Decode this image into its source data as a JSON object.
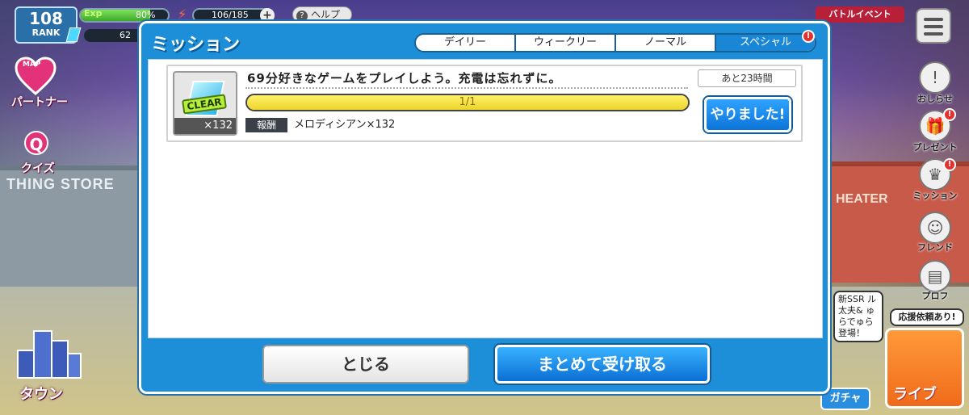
{
  "hud": {
    "rank": "108",
    "rank_label": "RANK",
    "exp_label": "Exp",
    "exp_percent": "80%",
    "exp_fraction": 0.8,
    "stamina": "106/185",
    "gems": "62",
    "help": "ヘルプ"
  },
  "left_menu": {
    "map_tag": "MAP",
    "partner": "パートナー",
    "quiz": "クイズ",
    "town": "タウン"
  },
  "background": {
    "store_sign": "THING STORE",
    "theater_sign": "HEATER"
  },
  "right_menu": {
    "event": "バトルイベント",
    "news": "おしらせ",
    "present": "プレゼント",
    "mission": "ミッション",
    "friend": "フレンド",
    "profile": "プロフ",
    "news_bubble": "新SSR ル太夫& ゅらでゅら 登場！",
    "support_request": "応援依頼あり!",
    "live": "ライブ",
    "gacha": "ガチャ"
  },
  "modal": {
    "title": "ミッション",
    "tabs": [
      {
        "label": "デイリー",
        "active": false
      },
      {
        "label": "ウィークリー",
        "active": false
      },
      {
        "label": "ノーマル",
        "active": false
      },
      {
        "label": "スペシャル",
        "active": true
      }
    ],
    "tab_badge": "!",
    "missions": [
      {
        "title": "69分好きなゲームをプレイしよう。充電は忘れずに。",
        "progress_text": "1/1",
        "progress_fraction": 1.0,
        "reward_label": "報酬",
        "reward": "メロディシアン×132",
        "reward_qty": "×132",
        "clear_tag": "CLEAR",
        "time_left": "あと23時間",
        "done_button": "やりました!"
      }
    ],
    "close_button": "とじる",
    "claim_all_button": "まとめて受け取る"
  }
}
